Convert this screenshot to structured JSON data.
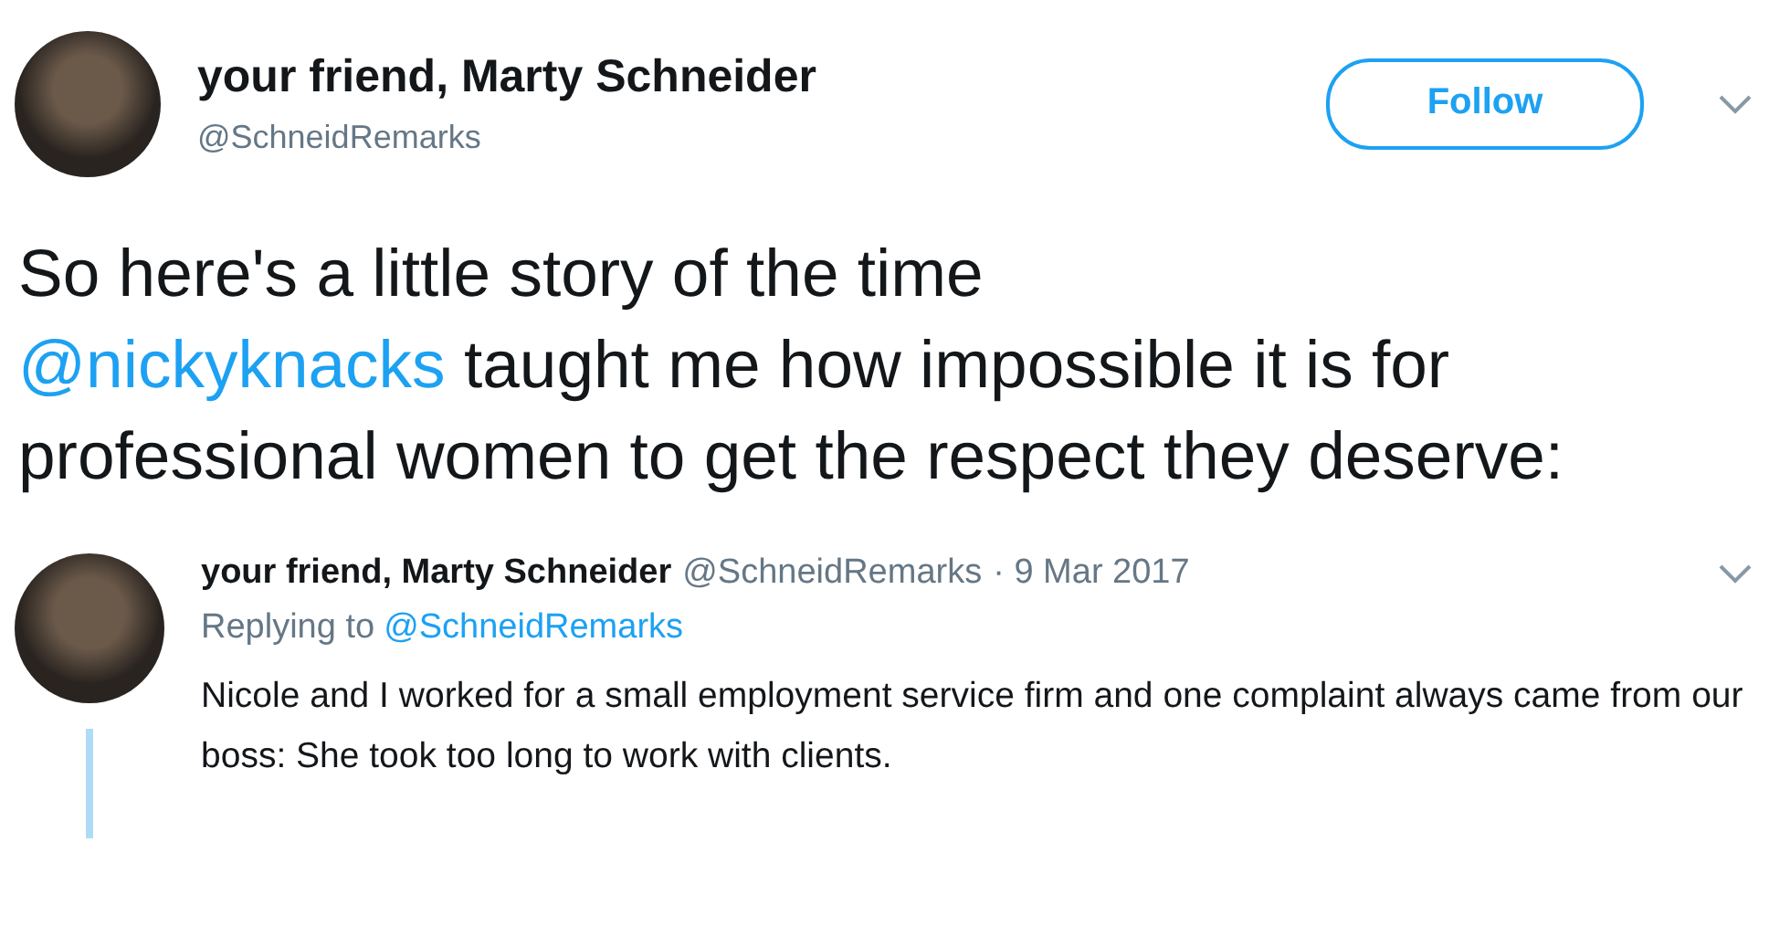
{
  "header": {
    "name": "your friend, Marty Schneider",
    "handle": "@SchneidRemarks",
    "follow_button": "Follow"
  },
  "tweet": {
    "text_before": "So here's a little story of the time",
    "mention": "@nickyknacks",
    "text_after": "taught me how impossible it is for professional women to get the respect they deserve:"
  },
  "reply": {
    "name": "your friend, Marty Schneider",
    "handle": "@SchneidRemarks",
    "date": "· 9 Mar 2017",
    "replying_label": "Replying to",
    "replying_handle": "@SchneidRemarks",
    "text": "Nicole and I worked for a small employment service firm and one complaint always came from our boss: She took too long to work with clients."
  }
}
